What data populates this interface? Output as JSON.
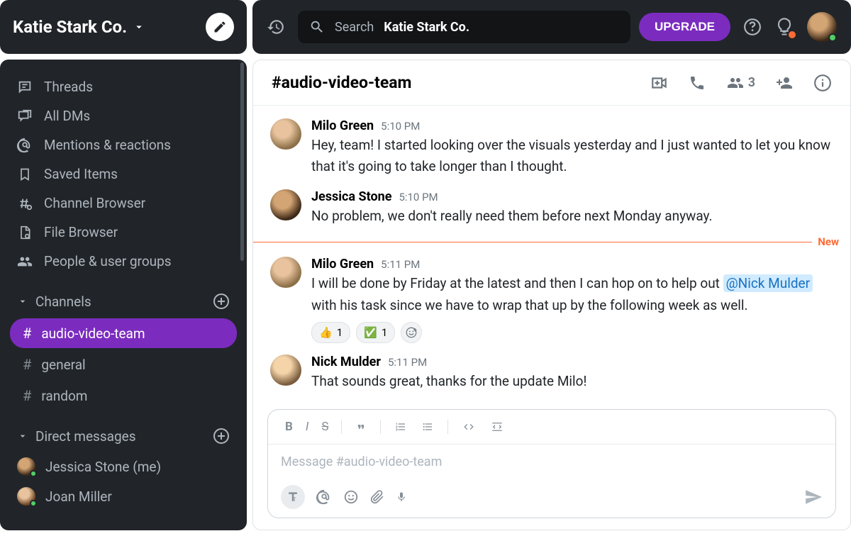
{
  "workspace": {
    "name": "Katie Stark Co."
  },
  "search": {
    "prefix": "Search",
    "target": "Katie Stark Co."
  },
  "upgrade": {
    "label": "UPGRADE"
  },
  "sidebar": {
    "nav": [
      {
        "label": "Threads",
        "icon": "threads"
      },
      {
        "label": "All DMs",
        "icon": "dms"
      },
      {
        "label": "Mentions & reactions",
        "icon": "mentions"
      },
      {
        "label": "Saved Items",
        "icon": "bookmark"
      },
      {
        "label": "Channel Browser",
        "icon": "channel-browser"
      },
      {
        "label": "File Browser",
        "icon": "file-browser"
      },
      {
        "label": "People & user groups",
        "icon": "people"
      }
    ],
    "channels_header": "Channels",
    "channels": [
      {
        "name": "audio-video-team",
        "active": true
      },
      {
        "name": "general",
        "active": false
      },
      {
        "name": "random",
        "active": false
      }
    ],
    "dms_header": "Direct messages",
    "dms": [
      {
        "name": "Jessica Stone (me)"
      },
      {
        "name": "Joan Miller"
      }
    ]
  },
  "channel": {
    "title": "#audio-video-team",
    "member_count": "3"
  },
  "divider": {
    "label": "New"
  },
  "messages": [
    {
      "author": "Milo Green",
      "time": "5:10 PM",
      "text": "Hey, team! I started looking over the visuals yesterday and I just wanted to let you know that it's going to take longer than I thought.",
      "avatar": "av1"
    },
    {
      "author": "Jessica Stone",
      "time": "5:10 PM",
      "text": "No problem, we don't really need them before next Monday anyway.",
      "avatar": "av2"
    },
    {
      "author": "Milo Green",
      "time": "5:11 PM",
      "text_before": "I will be done by Friday at the latest and then I can hop on to help out ",
      "mention": "@Nick Mulder",
      "text_after": " with his task since we have to wrap that up by the following week as well.",
      "avatar": "av1",
      "reactions": [
        {
          "emoji": "👍",
          "count": "1"
        },
        {
          "emoji": "✅",
          "count": "1"
        }
      ]
    },
    {
      "author": "Nick Mulder",
      "time": "5:11 PM",
      "text": "That sounds great, thanks for the update Milo!",
      "avatar": "av3"
    }
  ],
  "composer": {
    "placeholder": "Message #audio-video-team"
  }
}
